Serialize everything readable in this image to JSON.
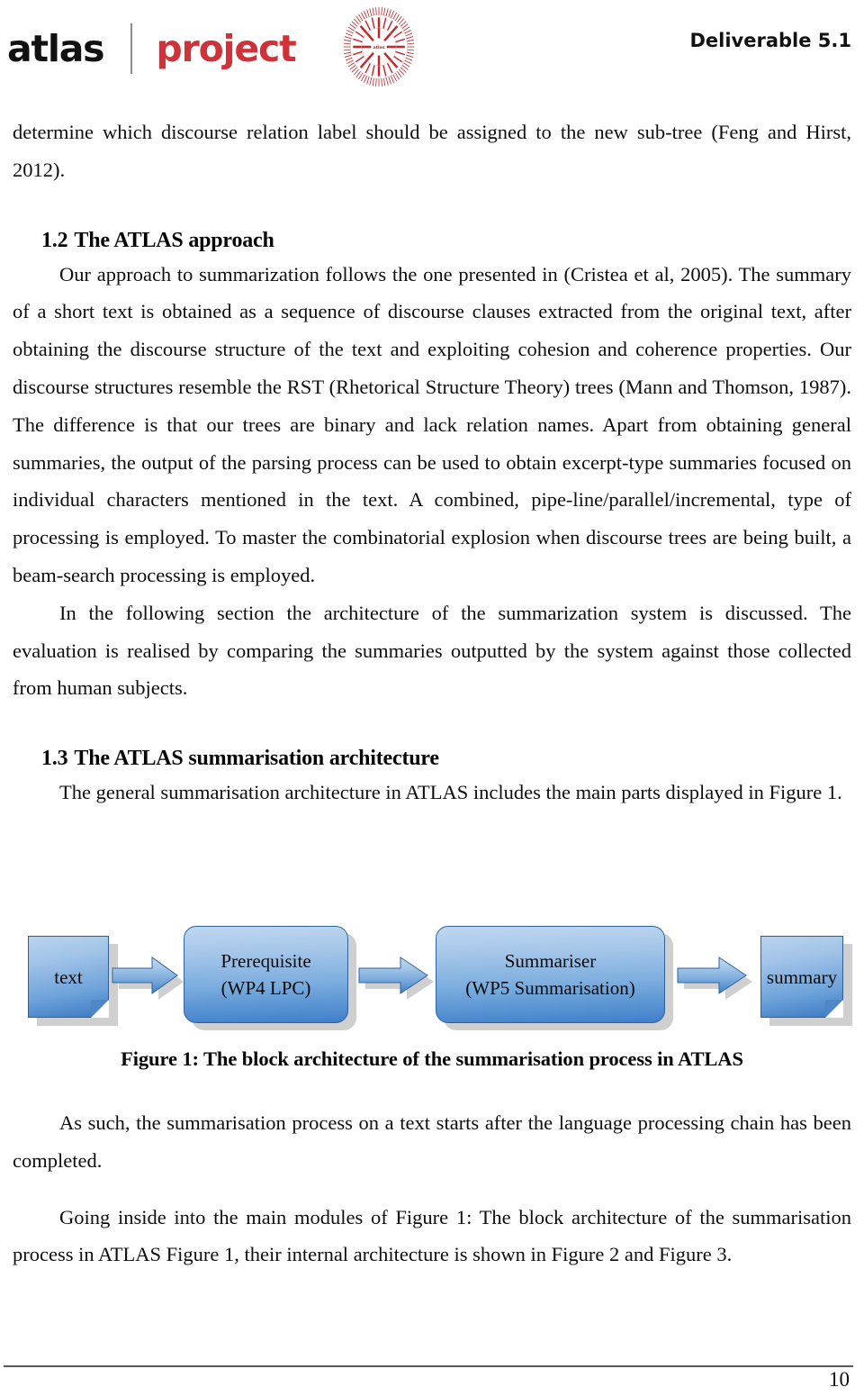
{
  "header": {
    "logo_atlas": "atlas",
    "logo_project": "project",
    "emblem_icon": "atlas-radial-emblem-icon",
    "deliverable": "Deliverable 5.1"
  },
  "body": {
    "para_top": "determine which discourse relation label should be assigned to the new sub-tree (Feng and Hirst, 2012).",
    "section_1_2": {
      "number": "1.2",
      "title": "The ATLAS approach",
      "paragraph": "Our approach to summarization follows the one presented in (Cristea et al, 2005). The summary of a short text is obtained as a sequence of discourse clauses extracted from the original text, after obtaining the discourse structure of the text and exploiting cohesion and coherence properties. Our discourse structures resemble the RST (Rhetorical Structure Theory) trees (Mann and Thomson, 1987). The difference is that our trees are binary and lack relation names. Apart from obtaining general summaries, the output of the parsing process can be used to obtain excerpt-type summaries focused on individual characters mentioned in the text. A combined, pipe-line/parallel/incremental, type of processing is employed. To master the combinatorial explosion when discourse trees are being built, a beam-search processing is employed.",
      "paragraph_2": "In the following section the architecture of the summarization system is discussed. The evaluation is realised by comparing the summaries outputted by the system against those collected from human subjects."
    },
    "section_1_3": {
      "number": "1.3",
      "title": "The ATLAS summarisation architecture",
      "paragraph": "The general summarisation architecture in ATLAS includes the main parts displayed in Figure 1."
    },
    "para_after_figure_1": "As such, the summarisation process on a text starts after the language processing chain has been completed.",
    "para_after_figure_2": "Going inside into the main modules of Figure 1: The block architecture of the summarisation process in ATLAS Figure 1, their internal architecture is shown in Figure 2 and Figure 3."
  },
  "figure": {
    "caption": "Figure 1: The block architecture of the summarisation process in ATLAS",
    "nodes": [
      {
        "id": "input-text",
        "label": "text",
        "shape": "document"
      },
      {
        "id": "prerequisite",
        "label_line1": "Prerequisite",
        "label_line2": "(WP4 LPC)",
        "shape": "rounded-rect"
      },
      {
        "id": "summariser",
        "label_line1": "Summariser",
        "label_line2": "(WP5 Summarisation)",
        "shape": "rounded-rect"
      },
      {
        "id": "output-summary",
        "label": "summary",
        "shape": "document"
      }
    ],
    "arrows": [
      {
        "id": "arrow-1",
        "from": "input-text",
        "to": "prerequisite"
      },
      {
        "id": "arrow-2",
        "from": "prerequisite",
        "to": "summariser"
      },
      {
        "id": "arrow-3",
        "from": "summariser",
        "to": "output-summary"
      }
    ],
    "colors": {
      "fill_light": "#bfd7f0",
      "fill_dark": "#3f7fca",
      "border": "#2f629c",
      "shadow": "#cfcfcf"
    }
  },
  "footer": {
    "page_number": "10"
  }
}
